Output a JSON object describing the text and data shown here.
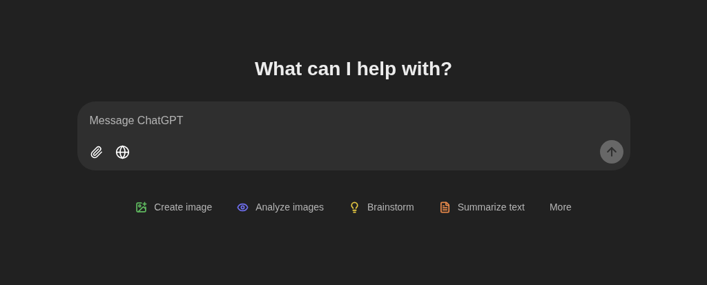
{
  "heading": "What can I help with?",
  "composer": {
    "placeholder": "Message ChatGPT",
    "send_disabled": true
  },
  "suggestions": [
    {
      "kind": "image",
      "label": "Create image",
      "color": "#5fb85f"
    },
    {
      "kind": "eye",
      "label": "Analyze images",
      "color": "#6f6ff0"
    },
    {
      "kind": "bulb",
      "label": "Brainstorm",
      "color": "#e2c541"
    },
    {
      "kind": "doc",
      "label": "Summarize text",
      "color": "#e8894a"
    },
    {
      "kind": "more",
      "label": "More"
    }
  ]
}
